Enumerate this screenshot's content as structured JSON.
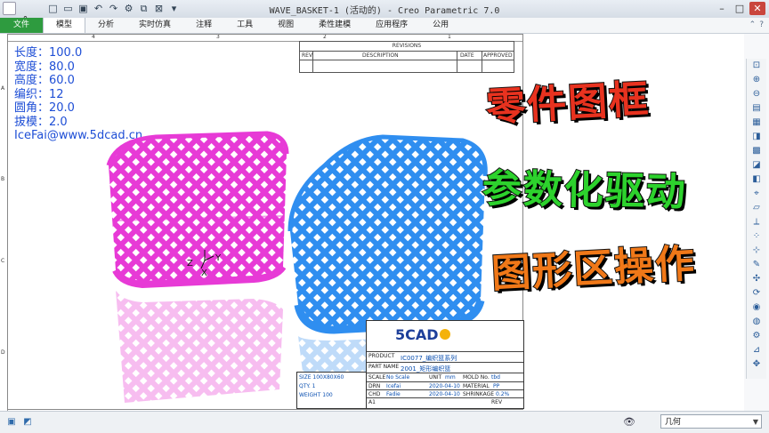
{
  "window": {
    "title": "WAVE_BASKET-1 (活动的) - Creo Parametric 7.0",
    "app_logo": "creo°"
  },
  "quick_access_icons": [
    "new-icon",
    "open-icon",
    "save-icon",
    "undo-icon",
    "redo-icon",
    "regenerate-icon",
    "windows-icon",
    "close-window-icon",
    "more-icon"
  ],
  "tabs": [
    {
      "label": "文件",
      "state": "file"
    },
    {
      "label": "模型",
      "state": "active"
    },
    {
      "label": "分析",
      "state": ""
    },
    {
      "label": "实时仿真",
      "state": ""
    },
    {
      "label": "注释",
      "state": ""
    },
    {
      "label": "工具",
      "state": ""
    },
    {
      "label": "视图",
      "state": ""
    },
    {
      "label": "柔性建模",
      "state": ""
    },
    {
      "label": "应用程序",
      "state": ""
    },
    {
      "label": "公用",
      "state": ""
    }
  ],
  "ruler": {
    "top": [
      "4",
      "3",
      "2",
      "1"
    ],
    "left": [
      "A",
      "B",
      "C",
      "D"
    ]
  },
  "revisions": {
    "title": "REVISIONS",
    "headers": [
      "REV",
      "DESCRIPTION",
      "DATE",
      "APPROVED"
    ]
  },
  "parameters": [
    "长度：100.0",
    "宽度：80.0",
    "高度：60.0",
    "编织：12",
    "圆角：20.0",
    "拔模：2.0",
    "IceFai@www.5dcad.cn"
  ],
  "axis_labels": {
    "z": "Z",
    "y": "Y",
    "x": "X"
  },
  "headlines": [
    "零件图框",
    "参数化驱动",
    "图形区操作"
  ],
  "colors": {
    "basket_left": "#e73ad6",
    "basket_right": "#2f8ef0",
    "params_text": "#1f4fd6",
    "file_tab": "#2e9b3f"
  },
  "title_block": {
    "product_label": "PRODUCT",
    "product_value": "IC0077_编织篮系列",
    "partname_label": "PART NAME",
    "partname_value": "2001_矩形编织篮",
    "scale_label": "SCALE",
    "scale_value": "No Scale",
    "unit_label": "UNIT",
    "unit_value": "mm",
    "mold_label": "MOLD No.",
    "mold_value": "tbd",
    "drn_label": "DRN",
    "drn_value": "Icefai",
    "drn_date": "2020-04-10",
    "material_label": "MATERIAL",
    "material_value": "PP",
    "chd_label": "CHD",
    "chd_value": "Fadie",
    "chd_date": "2020-04-10",
    "shrink_label": "SHRINKAGE",
    "shrink_value": "0.2%",
    "size_label": "A1",
    "sheet_label": "REV",
    "size_text": "SIZE",
    "size_dims": "100X80X60",
    "qty_label": "QTY.",
    "qty_value": "1",
    "weight_label": "WEIGHT",
    "weight_value": "100",
    "logo_text": "5CAD"
  },
  "status": {
    "filter_value": "几何"
  }
}
